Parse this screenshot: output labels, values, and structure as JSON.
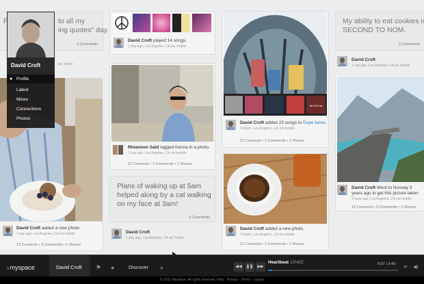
{
  "profile": {
    "name": "David Croft",
    "menu": [
      "Profile",
      "Latest",
      "Mixes",
      "Connections",
      "Photos"
    ]
  },
  "posts": {
    "quote1": {
      "text": "F... to all my ... quotes\" day.",
      "text_a": "F",
      "text_b": "to all my",
      "text_c": "ing quotes\" day.",
      "actions": "3 Comments",
      "meta_sub": "via Twitter"
    },
    "photo1": {
      "name": "David Croft",
      "action": " added a new photo.",
      "sub": "1 day ago, Los Angeles, CA via mobile",
      "actions": "12 Connects  •  3 Comments  •  2 Shares"
    },
    "songs": {
      "name": "David Croft",
      "action": " played 14 songs.",
      "sub": "1 day ago, Los Angeles, CA via mobile"
    },
    "rhiannon": {
      "name": "Rhiannon Said",
      "action": " tagged Kenna in a photo.",
      "sub": "1 day ago, Los Angeles, CA via mobile",
      "actions": "12 Connects  •  3 Comments  •  2 Shares"
    },
    "quote2": {
      "text": "Plans of waking up at 5am helped along by a cat walking on my face at 3am!",
      "actions": "3 Comments",
      "name": "David Croft",
      "sub": "1 day ago, Los Angeles, CA via Twitter"
    },
    "songs23": {
      "name": "David Croft",
      "action": " added 23 songs to ",
      "link": "Dope tunes.",
      "sub": "4:02pm, Los Angeles, CA via mobile",
      "actions": "12 Connects  •  3 Comments  •  2 Shares",
      "tile_label": "MYTATHA"
    },
    "coffee": {
      "name": "David Croft",
      "action": " added a new photo.",
      "sub": "3:50pm, Los Angeles, CA via mobile",
      "actions": "12 Connects  •  3 Comments  •  2 Shares"
    },
    "quote3": {
      "text": "My ability to eat cookies is SECOND TO NOM.",
      "actions": "3 Comments",
      "name": "David Croft",
      "sub": "1 day ago, Los Angeles, CA via mobile"
    },
    "norway": {
      "name": "David Croft",
      "action": " Went to Norway 3 years ago to get this picture taken",
      "sub": "3 days ago, Los Angeles, CA via mobile",
      "actions": "12 Connects  •  3 Comments  •  2 Shares"
    }
  },
  "bar": {
    "logo": "myspace",
    "user": "David Croft",
    "discover": "Discover",
    "track": "Heartbeat",
    "artist": "JJAMZ",
    "time": "0:07 / 3:49"
  },
  "footer": "© 2012 Myspace. All rights reserved.  Help  ·  Privacy  ·  Terms  ·  Logout",
  "colors": {
    "accent": "#2a7ec0",
    "bar": "#1b1b1b"
  }
}
